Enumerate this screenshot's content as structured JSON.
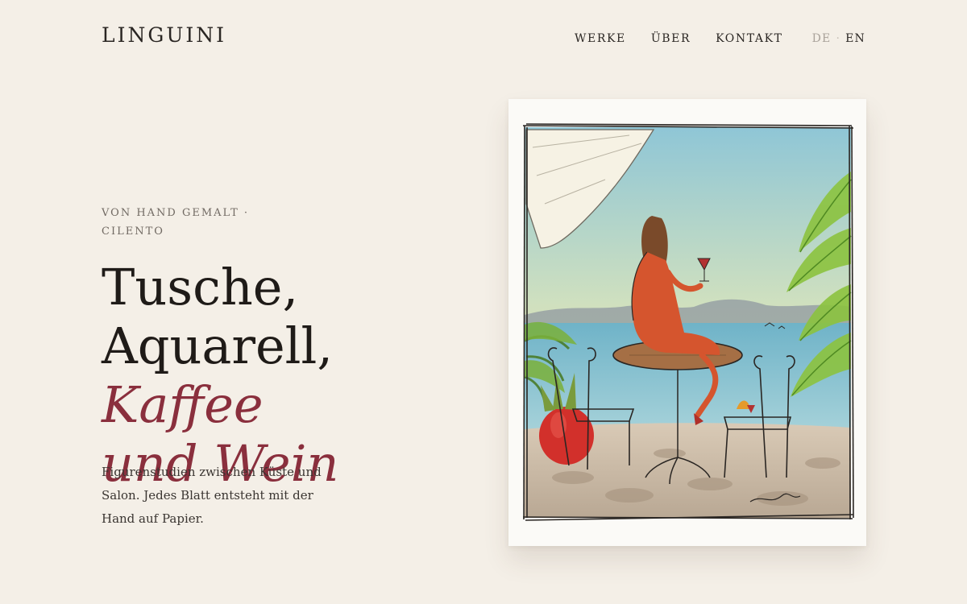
{
  "brand": "LINGUINI",
  "nav": {
    "items": [
      "WERKE",
      "ÜBER",
      "KONTAKT"
    ],
    "lang": {
      "de": "DE",
      "separator": "·",
      "en": "EN"
    }
  },
  "hero": {
    "eyebrow": "VON HAND GEMALT · CILENTO",
    "headline_line1": "Tusche,",
    "headline_line2": "Aquarell,",
    "headline_accent_1": "Kaffee",
    "headline_accent_2": "und Wein",
    "lead": "Figurenstudien zwischen Küste und Salon. Jedes Blatt entsteht mit der Hand auf Papier."
  },
  "artwork": {
    "subject": "watercolor-woman-with-wine-on-terrace"
  },
  "colors": {
    "background": "#f4efe7",
    "accent": "#8a2f3d",
    "text": "#1f1b18"
  }
}
